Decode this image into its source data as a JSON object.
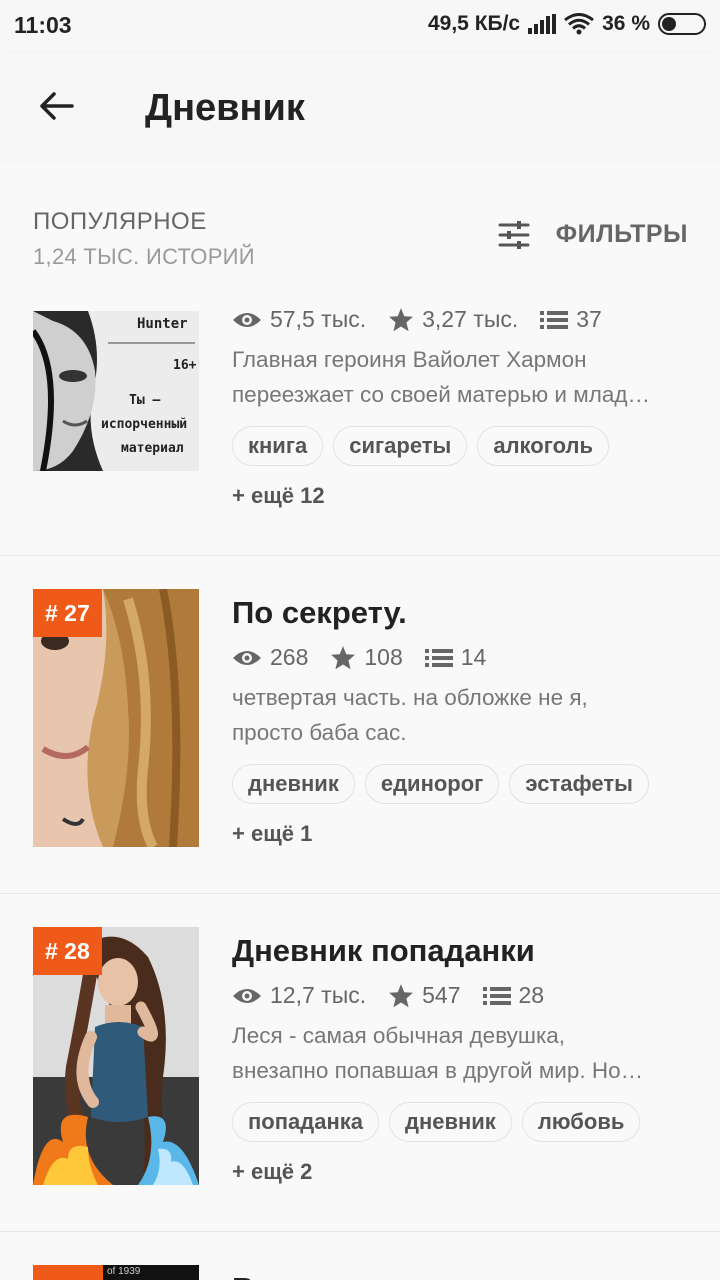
{
  "status_bar": {
    "time": "11:03",
    "speed": "49,5 КБ/с",
    "battery": "36 %"
  },
  "app_bar": {
    "title": "Дневник"
  },
  "section": {
    "title": "ПОПУЛЯРНОЕ",
    "subtitle": "1,24 ТЫС. ИСТОРИЙ",
    "filter_label": "ФИЛЬТРЫ"
  },
  "cover_texts": {
    "story1": [
      "Hunter",
      "16+",
      "Ты —",
      "испорченный",
      "материал"
    ],
    "story4": "of 1939"
  },
  "stories": [
    {
      "views": "57,5 тыс.",
      "votes": "3,27 тыс.",
      "parts": "37",
      "desc1": "Главная героиня Вайолет Хармон",
      "desc2": "переезжает со своей матерью и млад…",
      "tags": [
        "книга",
        "сигареты",
        "алкоголь"
      ],
      "more": "+ ещё 12"
    },
    {
      "rank": "# 27",
      "title": "По секрету.",
      "views": "268",
      "votes": "108",
      "parts": "14",
      "desc1": "четвертая часть. на обложке не я,",
      "desc2": "просто баба сас.",
      "tags": [
        "дневник",
        "единорог",
        "эстафеты"
      ],
      "more": "+ ещё 1"
    },
    {
      "rank": "# 28",
      "title": "Дневник попаданки",
      "views": "12,7 тыс.",
      "votes": "547",
      "parts": "28",
      "desc1": "Леся - самая обычная девушка,",
      "desc2": "внезапно попавшая в другой мир. Но…",
      "tags": [
        "попаданка",
        "дневник",
        "любовь"
      ],
      "more": "+ ещё 2"
    },
    {
      "title": "В"
    }
  ],
  "colors": {
    "accent": "#f05a19",
    "background": "#f9f9fa"
  }
}
